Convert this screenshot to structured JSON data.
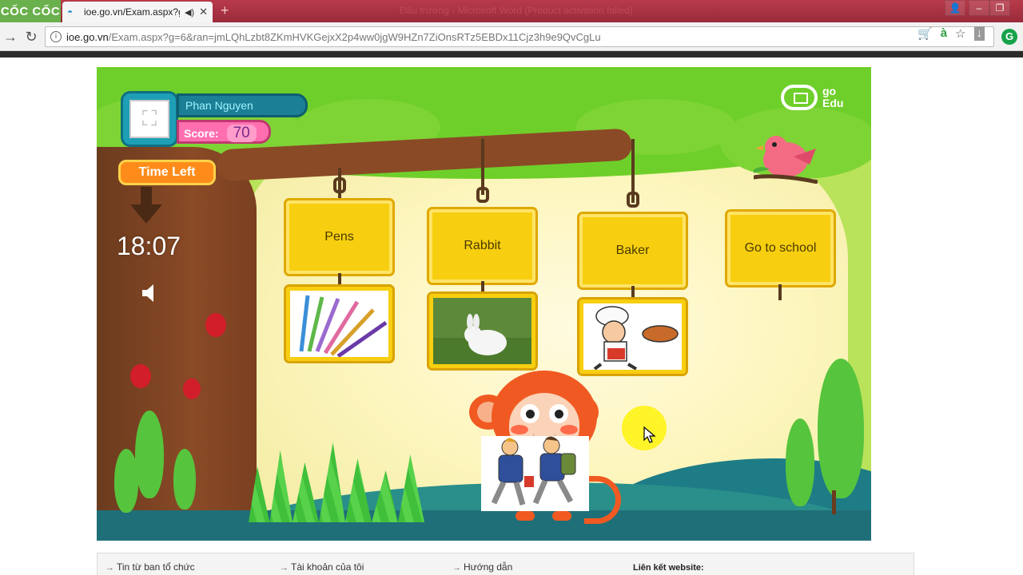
{
  "browser": {
    "brand": "CỐC CỐC",
    "tab_title": "ioe.go.vn/Exam.aspx?g",
    "window_title": "Đấu trường - Microsoft Word (Product activation failed)",
    "url_host": "ioe.go.vn",
    "url_path": "/Exam.aspx?g=6&ran=jmLQhLzbt8ZKmHVKGejxX2p4ww0jgW9HZn7ZiOnsRTz5EBDx11Cjz3h9e9QvCgLu",
    "ext_letter": "G"
  },
  "game": {
    "player_name": "Phan Nguyen",
    "score_label": "Score:",
    "score_value": "70",
    "time_left_label": "Time Left",
    "timer": "18:07",
    "logo_line1": "go",
    "logo_line2": "Edu",
    "cards": [
      {
        "label": "Pens",
        "picture": "pens"
      },
      {
        "label": "Rabbit",
        "picture": "rabbit"
      },
      {
        "label": "Baker",
        "picture": "baker"
      },
      {
        "label": "Go to school",
        "picture": ""
      }
    ],
    "held_picture": "students-going-to-school"
  },
  "footer": {
    "link1": "Tin từ ban tổ chức",
    "link2": "Tài khoản của tôi",
    "link3": "Hướng dẫn",
    "heading": "Liên kết website:"
  },
  "colors": {
    "canopy": "#6fcf2a",
    "card": "#f7cf10",
    "name_bar": "#1b7f95",
    "score_bar": "#ff6fb0",
    "time_left": "#ff8c1a"
  }
}
